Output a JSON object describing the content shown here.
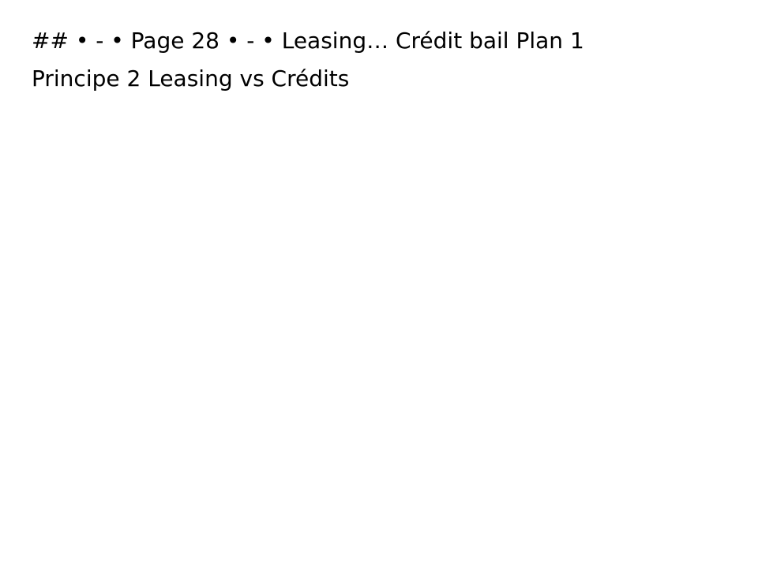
{
  "document": {
    "lines": [
      "## • - • Page 28 • - • Leasing… Crédit bail Plan 1",
      "Principe 2 Leasing vs Crédits"
    ]
  }
}
